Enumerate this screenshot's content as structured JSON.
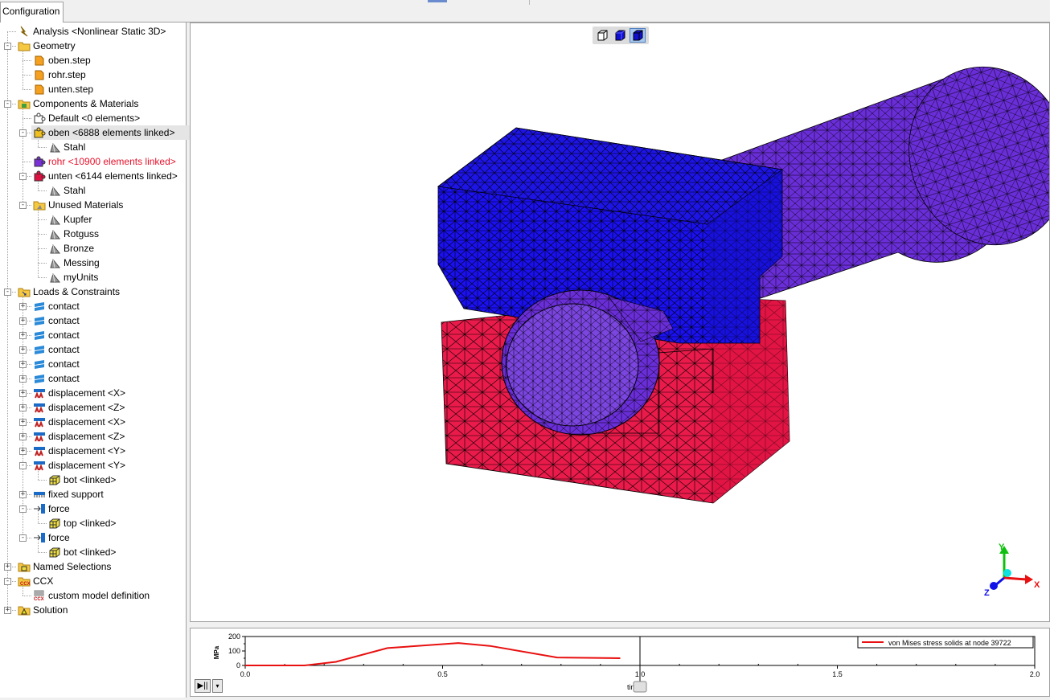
{
  "tab": {
    "label": "Configuration"
  },
  "tree": [
    {
      "label": "Analysis <Nonlinear Static 3D>",
      "icon": "analysis-icon",
      "depth": 0,
      "expander": ""
    },
    {
      "label": "Geometry",
      "icon": "folder-icon",
      "depth": 0,
      "expander": "-"
    },
    {
      "label": "oben.step",
      "icon": "step-file-icon",
      "depth": 1,
      "expander": ""
    },
    {
      "label": "rohr.step",
      "icon": "step-file-icon",
      "depth": 1,
      "expander": ""
    },
    {
      "label": "unten.step",
      "icon": "step-file-icon",
      "depth": 1,
      "expander": ""
    },
    {
      "label": "Components & Materials",
      "icon": "components-folder-icon",
      "depth": 0,
      "expander": "-"
    },
    {
      "label": "Default <0 elements>",
      "icon": "puzzle-white-icon",
      "depth": 1,
      "expander": ""
    },
    {
      "label": "oben <6888 elements linked>",
      "icon": "puzzle-yellow-icon",
      "depth": 1,
      "expander": "-",
      "selected": true
    },
    {
      "label": "Stahl",
      "icon": "material-icon",
      "depth": 2,
      "expander": ""
    },
    {
      "label": "rohr <10900 elements linked>",
      "icon": "puzzle-purple-icon",
      "depth": 1,
      "expander": "",
      "red": true
    },
    {
      "label": "unten <6144 elements linked>",
      "icon": "puzzle-red-icon",
      "depth": 1,
      "expander": "-"
    },
    {
      "label": "Stahl",
      "icon": "material-icon",
      "depth": 2,
      "expander": ""
    },
    {
      "label": "Unused Materials",
      "icon": "materials-folder-icon",
      "depth": 1,
      "expander": "-"
    },
    {
      "label": "Kupfer",
      "icon": "material-icon",
      "depth": 2,
      "expander": ""
    },
    {
      "label": "Rotguss",
      "icon": "material-icon",
      "depth": 2,
      "expander": ""
    },
    {
      "label": "Bronze",
      "icon": "material-icon",
      "depth": 2,
      "expander": ""
    },
    {
      "label": "Messing",
      "icon": "material-icon",
      "depth": 2,
      "expander": ""
    },
    {
      "label": "myUnits",
      "icon": "material-icon",
      "depth": 2,
      "expander": ""
    },
    {
      "label": "Loads & Constraints",
      "icon": "loads-folder-icon",
      "depth": 0,
      "expander": "-"
    },
    {
      "label": "contact",
      "icon": "contact-icon",
      "depth": 1,
      "expander": "+"
    },
    {
      "label": "contact",
      "icon": "contact-icon",
      "depth": 1,
      "expander": "+"
    },
    {
      "label": "contact",
      "icon": "contact-icon",
      "depth": 1,
      "expander": "+"
    },
    {
      "label": "contact",
      "icon": "contact-icon",
      "depth": 1,
      "expander": "+"
    },
    {
      "label": "contact",
      "icon": "contact-icon",
      "depth": 1,
      "expander": "+"
    },
    {
      "label": "contact",
      "icon": "contact-icon",
      "depth": 1,
      "expander": "+"
    },
    {
      "label": "displacement <X>",
      "icon": "displacement-icon",
      "depth": 1,
      "expander": "+"
    },
    {
      "label": "displacement <Z>",
      "icon": "displacement-icon",
      "depth": 1,
      "expander": "+"
    },
    {
      "label": "displacement <X>",
      "icon": "displacement-icon",
      "depth": 1,
      "expander": "+"
    },
    {
      "label": "displacement <Z>",
      "icon": "displacement-icon",
      "depth": 1,
      "expander": "+"
    },
    {
      "label": "displacement <Y>",
      "icon": "displacement-icon",
      "depth": 1,
      "expander": "+"
    },
    {
      "label": "displacement <Y>",
      "icon": "displacement-icon",
      "depth": 1,
      "expander": "-"
    },
    {
      "label": "bot <linked>",
      "icon": "node-set-icon",
      "depth": 2,
      "expander": ""
    },
    {
      "label": "fixed support",
      "icon": "fixed-support-icon",
      "depth": 1,
      "expander": "+"
    },
    {
      "label": "force",
      "icon": "force-icon",
      "depth": 1,
      "expander": "-"
    },
    {
      "label": "top <linked>",
      "icon": "node-set-icon",
      "depth": 2,
      "expander": ""
    },
    {
      "label": "force",
      "icon": "force-icon",
      "depth": 1,
      "expander": "-"
    },
    {
      "label": "bot <linked>",
      "icon": "node-set-icon",
      "depth": 2,
      "expander": ""
    },
    {
      "label": "Named Selections",
      "icon": "named-selections-icon",
      "depth": 0,
      "expander": "+"
    },
    {
      "label": "CCX",
      "icon": "ccx-icon",
      "depth": 0,
      "expander": "-"
    },
    {
      "label": "custom model definition",
      "icon": "ccx-definition-icon",
      "depth": 1,
      "expander": ""
    },
    {
      "label": "Solution",
      "icon": "solution-icon",
      "depth": 0,
      "expander": "+"
    }
  ],
  "viewport": {
    "view_buttons": [
      "wireframe-view-icon",
      "shaded-view-icon",
      "shaded-edges-view-icon"
    ],
    "axes": {
      "x": "X",
      "y": "Y",
      "z": "Z"
    },
    "part_colors": {
      "oben": "#1a10f0",
      "rohr": "#6a2ed8",
      "unten": "#ea1a4a"
    }
  },
  "plot": {
    "play_label": "▶||",
    "dropdown_label": "▾",
    "xaxis_label": "tim"
  },
  "chart_data": {
    "type": "line",
    "ylabel": "MPa",
    "xlabel": "tim",
    "xlim": [
      0,
      2.0
    ],
    "ylim": [
      0,
      200
    ],
    "yticks": [
      "200",
      "100",
      "0"
    ],
    "xticks": [
      "0.0",
      "0.5",
      "1.0",
      "1.5",
      "2.0"
    ],
    "current_time": 1.0,
    "series": [
      {
        "name": "von Mises stress solids at node 39722",
        "color": "#e81010",
        "x": [
          0.0,
          0.15,
          0.23,
          0.36,
          0.54,
          0.62,
          0.79,
          0.95
        ],
        "y": [
          0,
          0,
          25,
          120,
          155,
          135,
          55,
          50
        ]
      }
    ],
    "legend_position": "top-right"
  }
}
